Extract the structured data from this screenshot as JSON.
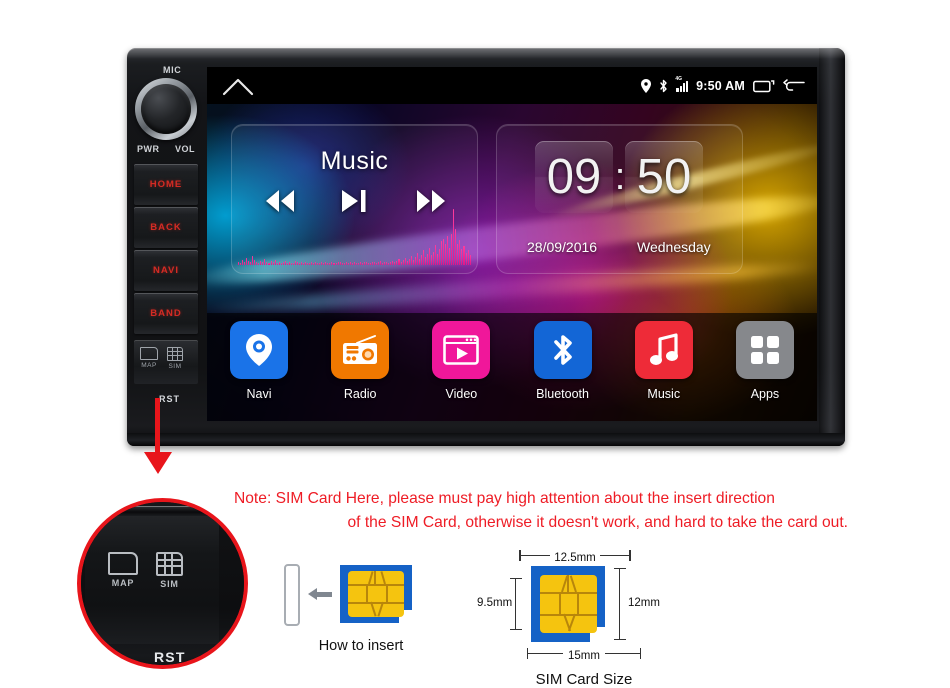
{
  "device": {
    "labels": {
      "mic": "MIC",
      "pwr": "PWR",
      "vol": "VOL",
      "rst": "RST",
      "map_slot": "MAP",
      "sim_slot": "SIM"
    },
    "buttons": [
      {
        "label": "HOME",
        "name": "home-hardware-button"
      },
      {
        "label": "BACK",
        "name": "back-hardware-button"
      },
      {
        "label": "NAVI",
        "name": "navi-hardware-button"
      },
      {
        "label": "BAND",
        "name": "band-hardware-button"
      }
    ]
  },
  "statusbar": {
    "home_icon": "home-icon",
    "location_icon": "location-pin-icon",
    "bluetooth_icon": "bluetooth-icon",
    "signal_icon": "signal-4g-icon",
    "network_label": "4G",
    "time": "9:50 AM",
    "recents_icon": "recents-icon",
    "back_icon": "back-arrow-icon"
  },
  "music_widget": {
    "title": "Music",
    "prev_icon": "rewind-icon",
    "play_icon": "play-pause-icon",
    "next_icon": "fast-forward-icon",
    "spectrum": [
      6,
      4,
      9,
      5,
      12,
      7,
      5,
      16,
      9,
      6,
      4,
      8,
      5,
      11,
      6,
      4,
      7,
      5,
      9,
      4,
      6,
      3,
      5,
      8,
      4,
      6,
      3,
      4,
      7,
      5,
      3,
      6,
      4,
      5,
      3,
      4,
      6,
      3,
      5,
      4,
      3,
      5,
      4,
      6,
      3,
      4,
      5,
      3,
      4,
      6,
      5,
      4,
      3,
      5,
      4,
      6,
      3,
      5,
      4,
      3,
      5,
      4,
      6,
      5,
      4,
      3,
      5,
      6,
      4,
      5,
      7,
      4,
      6,
      5,
      4,
      6,
      8,
      5,
      7,
      10,
      6,
      9,
      13,
      7,
      11,
      16,
      9,
      14,
      21,
      11,
      17,
      26,
      14,
      20,
      30,
      17,
      24,
      36,
      20,
      28,
      42,
      47,
      38,
      52,
      30,
      55,
      100,
      64,
      38,
      45,
      28,
      34,
      22,
      26,
      18
    ]
  },
  "clock_widget": {
    "hours": "09",
    "separator": ":",
    "minutes": "50",
    "date": "28/09/2016",
    "day": "Wednesday"
  },
  "apps": [
    {
      "label": "Navi",
      "icon": "navi-pin-icon",
      "color": "#1a73e8"
    },
    {
      "label": "Radio",
      "icon": "radio-icon",
      "color": "#f07800"
    },
    {
      "label": "Video",
      "icon": "video-play-icon",
      "color": "#f0179a"
    },
    {
      "label": "Bluetooth",
      "icon": "bluetooth-icon",
      "color": "#1366d6"
    },
    {
      "label": "Music",
      "icon": "music-note-icon",
      "color": "#ee2b38"
    },
    {
      "label": "Apps",
      "icon": "apps-grid-icon",
      "color": "#86888c"
    }
  ],
  "note": {
    "line1": "Note: SIM Card Here, please must pay high attention about the insert direction",
    "line2": "of the SIM Card, otherwise it doesn't work, and hard to take the card out."
  },
  "detail_circle": {
    "map_label": "MAP",
    "sim_label": "SIM",
    "rst_label": "RST"
  },
  "how_to_insert": {
    "caption": "How to insert",
    "arrow_icon": "left-arrow-icon",
    "slot_icon": "card-slot-icon"
  },
  "sim_size": {
    "caption": "SIM Card Size",
    "top_width": "12.5mm",
    "bottom_width": "15mm",
    "left_height": "9.5mm",
    "right_height": "12mm"
  },
  "colors": {
    "note_red": "#ee1c25",
    "arrow_red": "#e8151b",
    "sim_blue": "#1562c6",
    "sim_gold": "#f5c40f",
    "button_red": "#d42b24"
  }
}
